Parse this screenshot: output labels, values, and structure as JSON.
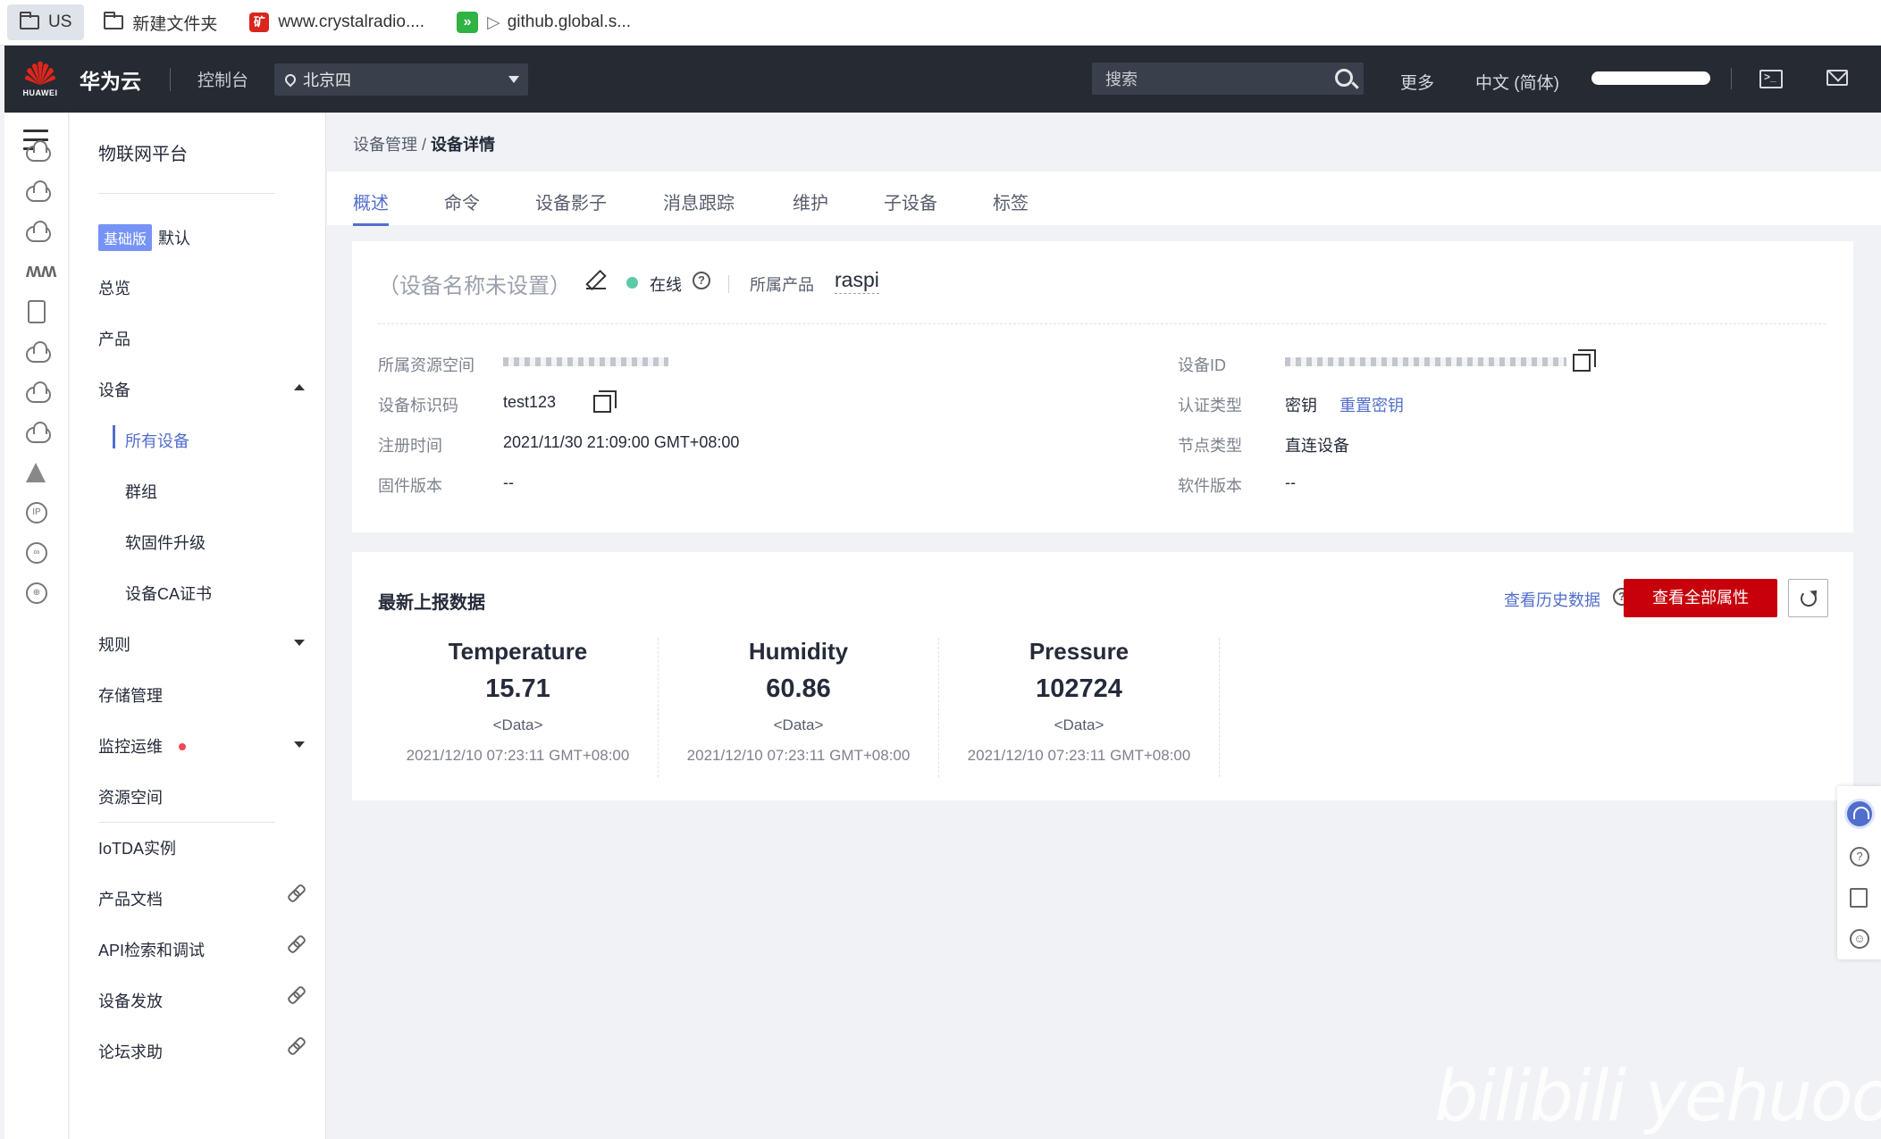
{
  "bookmarks": [
    {
      "label": "US",
      "icon": "folder-icon"
    },
    {
      "label": "新建文件夹",
      "icon": "folder-icon"
    },
    {
      "label": "www.crystalradio....",
      "icon": "red-app-icon"
    },
    {
      "label": "github.global.s...",
      "icon": "green-app-icon"
    }
  ],
  "header": {
    "logo_text": "HUAWEI",
    "brand": "华为云",
    "console": "控制台",
    "region": "北京四",
    "search_placeholder": "搜索",
    "more": "更多",
    "language": "中文 (简体)"
  },
  "nav": {
    "title": "物联网平台",
    "edition_tag": "基础版",
    "edition_name": "默认",
    "items": {
      "overview": "总览",
      "products": "产品",
      "devices": "设备",
      "all_devices": "所有设备",
      "groups": "群组",
      "ota": "软固件升级",
      "ca_cert": "设备CA证书",
      "rules": "规则",
      "storage": "存储管理",
      "monitoring": "监控运维",
      "resource_space": "资源空间",
      "iotda": "IoTDA实例",
      "docs": "产品文档",
      "api": "API检索和调试",
      "provisioning": "设备发放",
      "forum": "论坛求助"
    }
  },
  "breadcrumb": {
    "parent": "设备管理",
    "sep": "/",
    "current": "设备详情"
  },
  "tabs": [
    "概述",
    "命令",
    "设备影子",
    "消息跟踪",
    "维护",
    "子设备",
    "标签"
  ],
  "device": {
    "name": "（设备名称未设置）",
    "status": "在线",
    "product_label": "所属产品",
    "product": "raspi",
    "fields": {
      "resource_space_label": "所属资源空间",
      "identifier_label": "设备标识码",
      "identifier": "test123",
      "reg_time_label": "注册时间",
      "reg_time": "2021/11/30 21:09:00 GMT+08:00",
      "firmware_label": "固件版本",
      "firmware": "--",
      "device_id_label": "设备ID",
      "auth_type_label": "认证类型",
      "auth_type": "密钥",
      "reset_key": "重置密钥",
      "node_type_label": "节点类型",
      "node_type": "直连设备",
      "software_label": "软件版本",
      "software": "--"
    }
  },
  "reported": {
    "title": "最新上报数据",
    "history_link": "查看历史数据",
    "view_all_button": "查看全部属性",
    "properties": [
      {
        "name": "Temperature",
        "value": "15.71",
        "type": "<Data>",
        "time": "2021/12/10 07:23:11 GMT+08:00"
      },
      {
        "name": "Humidity",
        "value": "60.86",
        "type": "<Data>",
        "time": "2021/12/10 07:23:11 GMT+08:00"
      },
      {
        "name": "Pressure",
        "value": "102724",
        "type": "<Data>",
        "time": "2021/12/10 07:23:11 GMT+08:00"
      }
    ]
  },
  "watermark": "bilibili yehuoone",
  "colors": {
    "accent": "#526ecc",
    "primary_button": "#c7000b",
    "header_bg": "#252a33",
    "online": "#5dc9a8"
  }
}
